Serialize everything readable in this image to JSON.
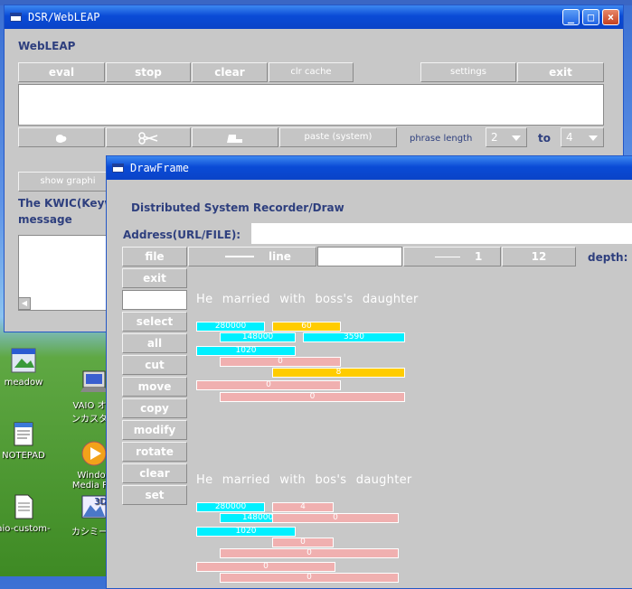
{
  "webleap": {
    "title": "DSR/WebLEAP",
    "app_label": "WebLEAP",
    "toolbar": {
      "eval": "eval",
      "stop": "stop",
      "clear": "clear",
      "clr_cache": "clr cache",
      "settings": "settings",
      "exit": "exit"
    },
    "paste_label": "paste (system)",
    "phrase_length_label": "phrase length",
    "phrase_from": "2",
    "to_label": "to",
    "phrase_to": "4",
    "show_graph_label": "show graphi",
    "kwic_label": "The KWIC(Keywo",
    "message_label": "message"
  },
  "desktop_icons": [
    {
      "label": "meadow",
      "icon": "meadow-icon"
    },
    {
      "label": "VAIO オン\nンカスタマ",
      "icon": "vaio-icon"
    },
    {
      "label": "NOTEPAD",
      "icon": "notepad-icon"
    },
    {
      "label": "Windov\nMedia Pla",
      "icon": "media-player-icon"
    },
    {
      "label": "aio-custom-",
      "icon": "document-icon"
    },
    {
      "label": "カシミール",
      "icon": "kashmir-3d-icon"
    }
  ],
  "drawframe": {
    "title": "DrawFrame",
    "heading": "Distributed System Recorder/Draw",
    "address_label": "Address(URL/FILE):",
    "address_value": "",
    "toolbar": {
      "file": "file",
      "line": "line",
      "value1": "1",
      "value2": "12",
      "depth_label": "depth:"
    },
    "tools": [
      "exit",
      "select",
      "all",
      "cut",
      "move",
      "copy",
      "modify",
      "rotate",
      "clear",
      "set"
    ],
    "sentence1": "He married with boss's daughter",
    "sentence2": "He married with bos's daughter",
    "bars1": [
      {
        "label": "280000",
        "color": "#00f0ff"
      },
      {
        "label": "60",
        "color": "#ffcc00"
      },
      {
        "label": "148000",
        "color": "#00f0ff"
      },
      {
        "label": "3590",
        "color": "#00f0ff"
      },
      {
        "label": "1020",
        "color": "#00f0ff"
      },
      {
        "label": "0",
        "color": "#f0b0b0"
      },
      {
        "label": "8",
        "color": "#ffcc00"
      },
      {
        "label": "0",
        "color": "#f0b0b0"
      },
      {
        "label": "0",
        "color": "#f0b0b0"
      }
    ],
    "bars2": [
      {
        "label": "280000",
        "color": "#00f0ff"
      },
      {
        "label": "4",
        "color": "#f0b0b0"
      },
      {
        "label": "148000",
        "color": "#00f0ff"
      },
      {
        "label": "0",
        "color": "#f0b0b0"
      },
      {
        "label": "1020",
        "color": "#00f0ff"
      },
      {
        "label": "0",
        "color": "#f0b0b0"
      },
      {
        "label": "0",
        "color": "#f0b0b0"
      },
      {
        "label": "0",
        "color": "#f0b0b0"
      },
      {
        "label": "0",
        "color": "#f0b0b0"
      }
    ]
  }
}
